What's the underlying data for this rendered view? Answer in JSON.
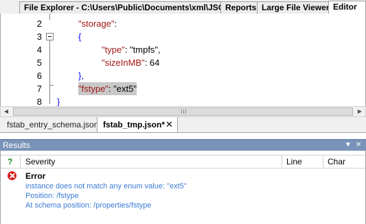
{
  "top_tabs": [
    {
      "label": "File Explorer - C:\\Users\\Public\\Documents\\xml\\JSON",
      "active": false
    },
    {
      "label": "Reports",
      "active": false
    },
    {
      "label": "Large File Viewer",
      "active": false
    },
    {
      "label": "Editor",
      "active": true
    }
  ],
  "editor": {
    "lines": [
      {
        "num": "2",
        "k": "\"storage\"",
        "rest": ":"
      },
      {
        "num": "3",
        "text": "{"
      },
      {
        "num": "4",
        "k": "\"type\"",
        "rest": ": \"tmpfs\","
      },
      {
        "num": "5",
        "k": "\"sizeInMB\"",
        "rest": ": 64"
      },
      {
        "num": "6",
        "text": "},"
      },
      {
        "num": "7",
        "k": "\"fstype\"",
        "rest": ": \"ext5\""
      },
      {
        "num": "8",
        "text": "}"
      }
    ]
  },
  "file_tabs": [
    {
      "label": "fstab_entry_schema.json",
      "active": false
    },
    {
      "label": "fstab_tmp.json*",
      "active": true
    }
  ],
  "file_tab_close": "✕",
  "results": {
    "title": "Results",
    "controls": {
      "dropdown": "▼",
      "close": "✕"
    },
    "columns": {
      "icon": "?",
      "severity": "Severity",
      "line": "Line",
      "char": "Char"
    },
    "error": {
      "severity": "Error",
      "messages": [
        "instance does not match any enum value: \"ext5\"",
        "Position: /fstype",
        "At schema position: /properties/fstype"
      ]
    }
  },
  "icons": {
    "error": "error-circle-icon",
    "fold": "fold-minus-icon",
    "grip": "scroll-grip-icon"
  },
  "colors": {
    "json_key": "#a31515",
    "json_brace": "#0000ff",
    "highlight": "#c8c8c8",
    "results_header": "#7a93b8",
    "error_text": "#3a7bd5",
    "error_icon": "#d42020"
  }
}
